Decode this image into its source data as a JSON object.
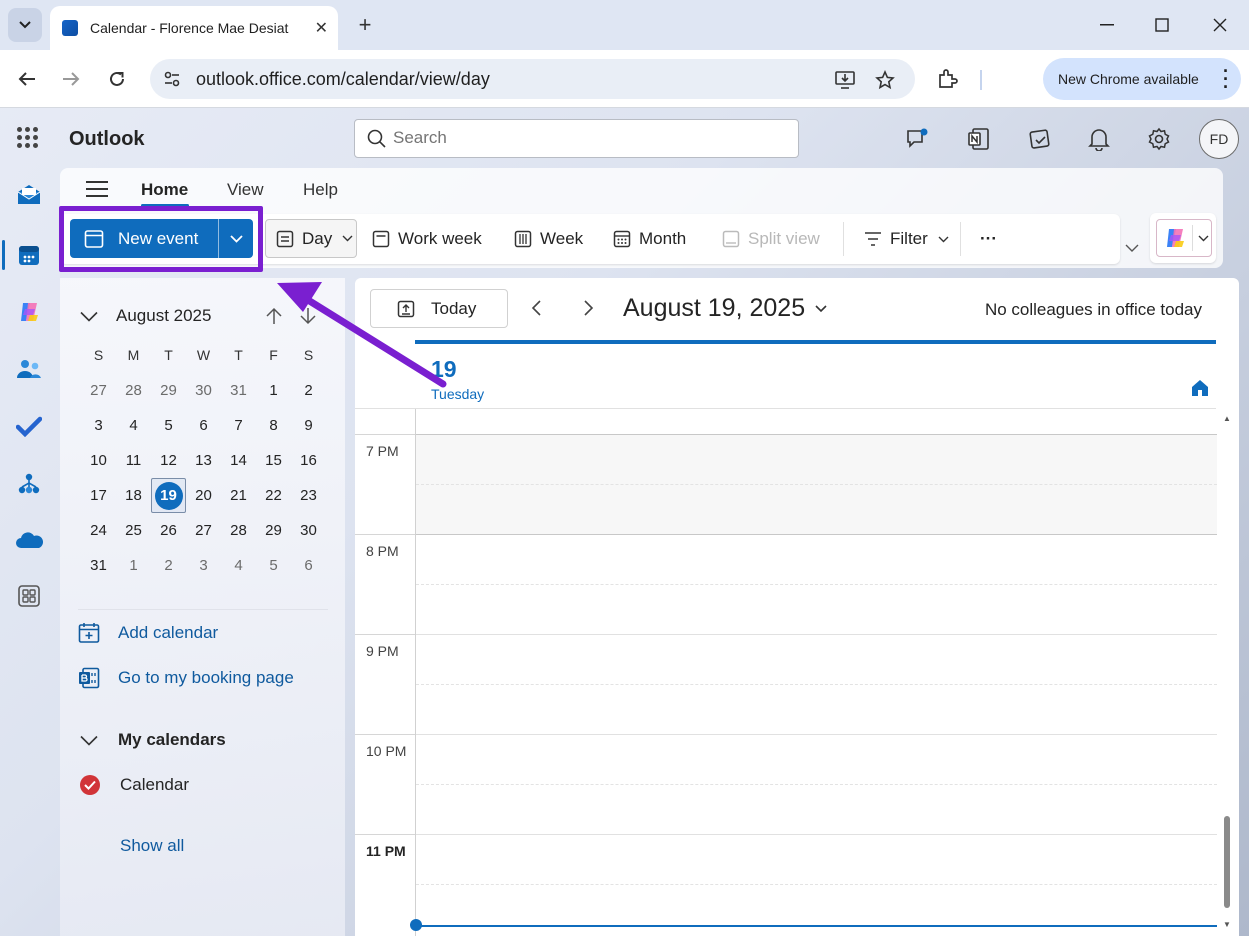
{
  "browser": {
    "tab_title": "Calendar - Florence Mae Desiat",
    "url": "outlook.office.com/calendar/view/day",
    "update_label": "New Chrome available"
  },
  "app": {
    "name": "Outlook",
    "search_placeholder": "Search",
    "user_initials": "FD"
  },
  "ribbon": {
    "tabs": [
      "Home",
      "View",
      "Help"
    ],
    "new_event_label": "New event",
    "commands": {
      "day": "Day",
      "work_week": "Work week",
      "week": "Week",
      "month": "Month",
      "split_view": "Split view",
      "filter": "Filter",
      "more": "···"
    }
  },
  "mini_calendar": {
    "month_label": "August 2025",
    "weekdays": [
      "S",
      "M",
      "T",
      "W",
      "T",
      "F",
      "S"
    ],
    "weeks": [
      [
        "27",
        "28",
        "29",
        "30",
        "31",
        "1",
        "2"
      ],
      [
        "3",
        "4",
        "5",
        "6",
        "7",
        "8",
        "9"
      ],
      [
        "10",
        "11",
        "12",
        "13",
        "14",
        "15",
        "16"
      ],
      [
        "17",
        "18",
        "19",
        "20",
        "21",
        "22",
        "23"
      ],
      [
        "24",
        "25",
        "26",
        "27",
        "28",
        "29",
        "30"
      ],
      [
        "31",
        "1",
        "2",
        "3",
        "4",
        "5",
        "6"
      ]
    ],
    "today": "19"
  },
  "left_pane": {
    "add_calendar": "Add calendar",
    "booking_page": "Go to my booking page",
    "my_calendars": "My calendars",
    "calendar_name": "Calendar",
    "show_all": "Show all"
  },
  "main": {
    "today_label": "Today",
    "date_title": "August 19, 2025",
    "office_note": "No colleagues in office today",
    "day_number": "19",
    "day_name": "Tuesday",
    "time_labels": [
      "7 PM",
      "8 PM",
      "9 PM",
      "10 PM",
      "11 PM"
    ]
  },
  "colors": {
    "accent": "#0f6cbd",
    "highlight": "#7a1fd0",
    "calendar_red": "#d13438"
  }
}
